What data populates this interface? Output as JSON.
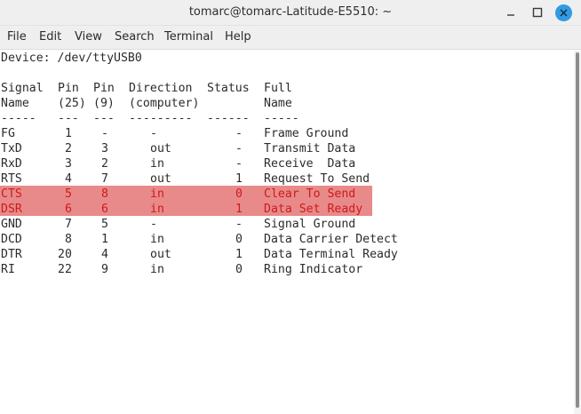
{
  "window": {
    "title": "tomarc@tomarc-Latitude-E5510: ~"
  },
  "menu": [
    "File",
    "Edit",
    "View",
    "Search",
    "Terminal",
    "Help"
  ],
  "terminal": {
    "device_line": "Device: /dev/ttyUSB0",
    "header1": [
      "Signal",
      "Pin",
      "Pin",
      "Direction",
      "Status",
      "Full"
    ],
    "header2": [
      "Name",
      "(25)",
      "(9)",
      "(computer)",
      "",
      "Name"
    ],
    "separator": [
      "-----",
      "---",
      "---",
      "---------",
      "------",
      "-----"
    ],
    "rows": [
      {
        "signal": "FG",
        "pin25": "1",
        "pin9": "-",
        "direction": "-",
        "status": "-",
        "full": "Frame Ground"
      },
      {
        "signal": "TxD",
        "pin25": "2",
        "pin9": "3",
        "direction": "out",
        "status": "-",
        "full": "Transmit Data"
      },
      {
        "signal": "RxD",
        "pin25": "3",
        "pin9": "2",
        "direction": "in",
        "status": "-",
        "full": "Receive  Data"
      },
      {
        "signal": "RTS",
        "pin25": "4",
        "pin9": "7",
        "direction": "out",
        "status": "1",
        "full": "Request To Send"
      },
      {
        "signal": "CTS",
        "pin25": "5",
        "pin9": "8",
        "direction": "in",
        "status": "0",
        "full": "Clear To Send"
      },
      {
        "signal": "DSR",
        "pin25": "6",
        "pin9": "6",
        "direction": "in",
        "status": "1",
        "full": "Data Set Ready"
      },
      {
        "signal": "GND",
        "pin25": "7",
        "pin9": "5",
        "direction": "-",
        "status": "-",
        "full": "Signal Ground"
      },
      {
        "signal": "DCD",
        "pin25": "8",
        "pin9": "1",
        "direction": "in",
        "status": "0",
        "full": "Data Carrier Detect"
      },
      {
        "signal": "DTR",
        "pin25": "20",
        "pin9": "4",
        "direction": "out",
        "status": "1",
        "full": "Data Terminal Ready"
      },
      {
        "signal": "RI",
        "pin25": "22",
        "pin9": "9",
        "direction": "in",
        "status": "0",
        "full": "Ring Indicator"
      }
    ],
    "highlighted_rows": [
      4,
      5
    ]
  },
  "colors": {
    "highlight_background": "#e88a8a",
    "highlight_text": "#cf1a1a",
    "close_button": "#2f9be4"
  },
  "icons": {
    "minimize": "minimize-icon",
    "maximize": "maximize-icon",
    "close": "close-icon"
  }
}
